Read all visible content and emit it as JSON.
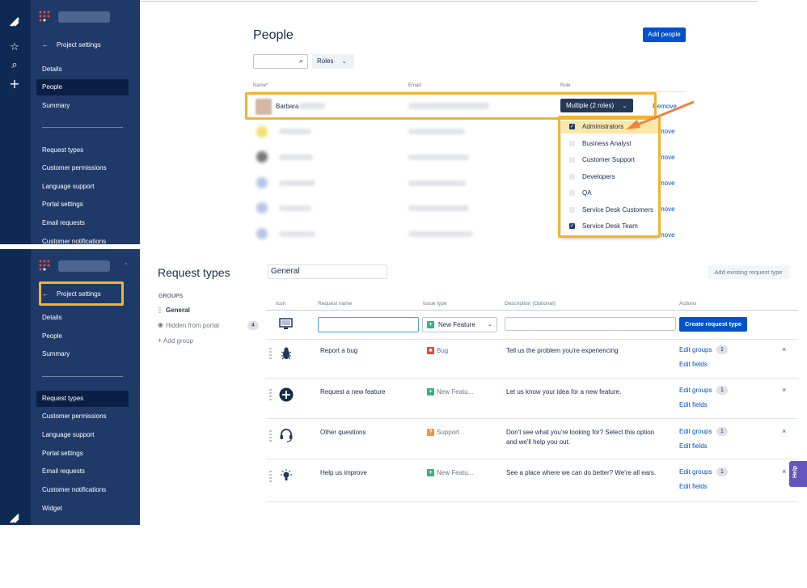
{
  "top": {
    "page_title": "People",
    "add_people_button": "Add people",
    "roles_filter": "Roles",
    "columns": {
      "name": "Name",
      "email": "Email",
      "role": "Role"
    },
    "first_row_name": "Barbara",
    "role_select": "Multiple (2 roles)",
    "remove_label": "Remove",
    "remove_partial": "move",
    "roles": [
      {
        "label": "Administrators",
        "checked": true
      },
      {
        "label": "Business Analyst",
        "checked": false
      },
      {
        "label": "Customer Support",
        "checked": false
      },
      {
        "label": "Developers",
        "checked": false
      },
      {
        "label": "QA",
        "checked": false
      },
      {
        "label": "Service Desk Customers",
        "checked": false
      },
      {
        "label": "Service Desk Team",
        "checked": true
      }
    ],
    "sidebar": {
      "back_label": "Project settings",
      "items": [
        "Details",
        "People",
        "Summary"
      ],
      "items2": [
        "Request types",
        "Customer permissions",
        "Language support",
        "Portal settings",
        "Email requests",
        "Customer notifications"
      ],
      "active": "People"
    }
  },
  "bottom": {
    "page_title": "Request types",
    "groups_heading": "GROUPS",
    "groups": [
      {
        "label": "General",
        "active": true
      },
      {
        "label": "Hidden from portal",
        "count": "4"
      }
    ],
    "add_group": "Add group",
    "group_name_value": "General",
    "add_existing_button": "Add existing request type",
    "columns": {
      "icon": "Icon",
      "request_name": "Request name",
      "issue_type": "Issue type",
      "description": "Description",
      "description_optional": "(Optional)",
      "actions": "Actions"
    },
    "new_row": {
      "issue_type": "New Feature",
      "create_button": "Create request type"
    },
    "rows": [
      {
        "icon": "bug-icon",
        "name": "Report a bug",
        "issue_type": "Bug",
        "issue_color": "#e5493a",
        "description": "Tell us the problem you're experiencing",
        "edit_groups": "Edit groups",
        "count": "1",
        "edit_fields": "Edit fields"
      },
      {
        "icon": "plus-circle-icon",
        "name": "Request a new feature",
        "issue_type": "New Featu...",
        "issue_color": "#36b37e",
        "description": "Let us know your idea for a new feature.",
        "edit_groups": "Edit groups",
        "count": "1",
        "edit_fields": "Edit fields"
      },
      {
        "icon": "headset-icon",
        "name": "Other questions",
        "issue_type": "Support",
        "issue_color": "#f79232",
        "description": "Don't see what you're looking for? Select this option and we'll help you out.",
        "edit_groups": "Edit groups",
        "count": "1",
        "edit_fields": "Edit fields"
      },
      {
        "icon": "lightbulb-icon",
        "name": "Help us improve",
        "issue_type": "New Featu...",
        "issue_color": "#36b37e",
        "description": "See a place where we can do better? We're all ears.",
        "edit_groups": "Edit groups",
        "count": "1",
        "edit_fields": "Edit fields"
      }
    ],
    "sidebar": {
      "back_label": "Project settings",
      "items": [
        "Details",
        "People",
        "Summary"
      ],
      "items2": [
        "Request types",
        "Customer permissions",
        "Language support",
        "Portal settings",
        "Email requests",
        "Customer notifications",
        "Widget"
      ],
      "active": "Request types"
    },
    "help_label": "Help"
  },
  "colors": {
    "rail": "#0e2a54",
    "sidebar": "#1f3a68",
    "primary": "#0052cc",
    "highlight": "#f1b42f"
  }
}
